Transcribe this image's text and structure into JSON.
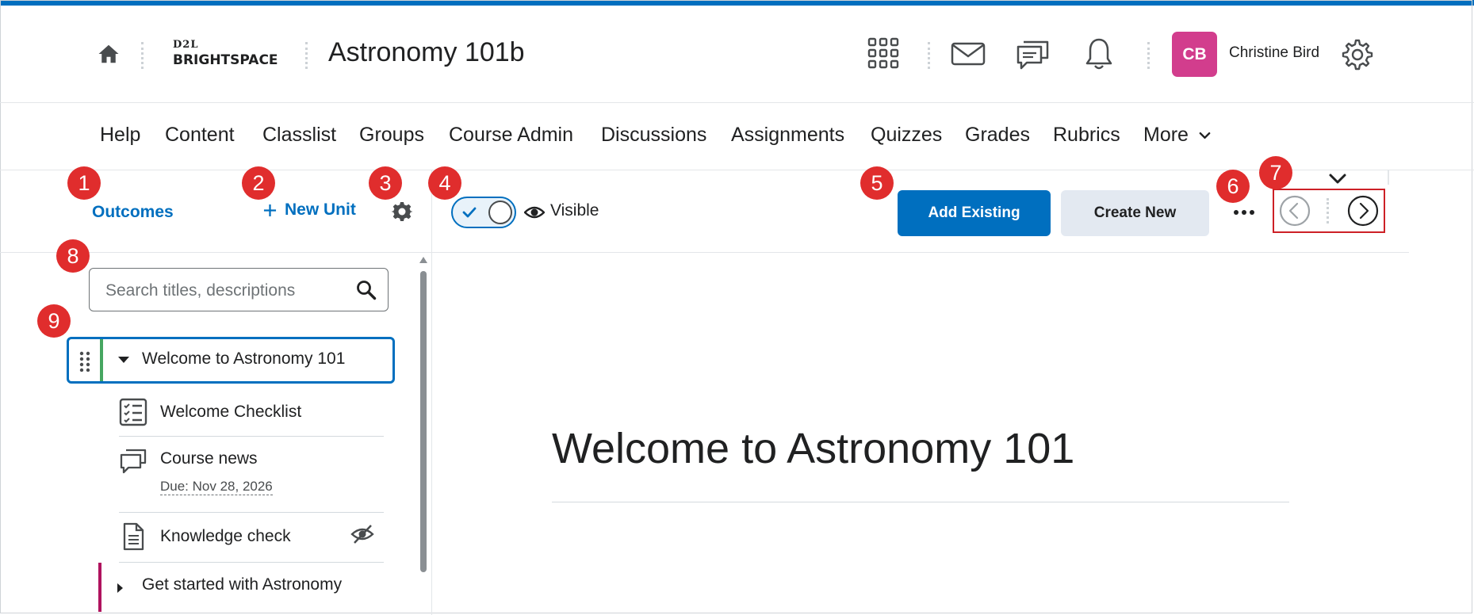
{
  "header": {
    "logo_top": "D2L",
    "logo_bottom": "BRIGHTSPACE",
    "course_title": "Astronomy 101b",
    "user_initials": "CB",
    "user_name": "Christine Bird"
  },
  "nav": {
    "items": [
      "Help",
      "Content",
      "Classlist",
      "Groups",
      "Course Admin",
      "Discussions",
      "Assignments",
      "Quizzes",
      "Grades",
      "Rubrics",
      "More"
    ]
  },
  "left_panel": {
    "outcomes_label": "Outcomes",
    "new_unit_label": "New Unit",
    "search_placeholder": "Search titles, descriptions",
    "selected_unit": "Welcome to Astronomy 101",
    "topics": [
      {
        "label": "Welcome Checklist",
        "icon": "checklist-icon"
      },
      {
        "label": "Course news",
        "due": "Due: Nov 28, 2026",
        "icon": "discussion-icon"
      },
      {
        "label": "Knowledge check",
        "icon": "document-icon",
        "hidden": true
      }
    ],
    "second_unit": "Get started with Astronomy"
  },
  "toolbar": {
    "visible_label": "Visible",
    "add_existing_label": "Add Existing",
    "create_new_label": "Create New"
  },
  "content": {
    "title": "Welcome to Astronomy 101"
  },
  "callouts": [
    "1",
    "2",
    "3",
    "4",
    "5",
    "6",
    "7",
    "8",
    "9"
  ],
  "colors": {
    "accent": "#006fbf",
    "callout": "#e02d2d",
    "avatar": "#d23d8d",
    "unit_bar_green": "#46a661",
    "unit_bar_magenta": "#b0135e",
    "highlight_box": "#cd2026"
  }
}
